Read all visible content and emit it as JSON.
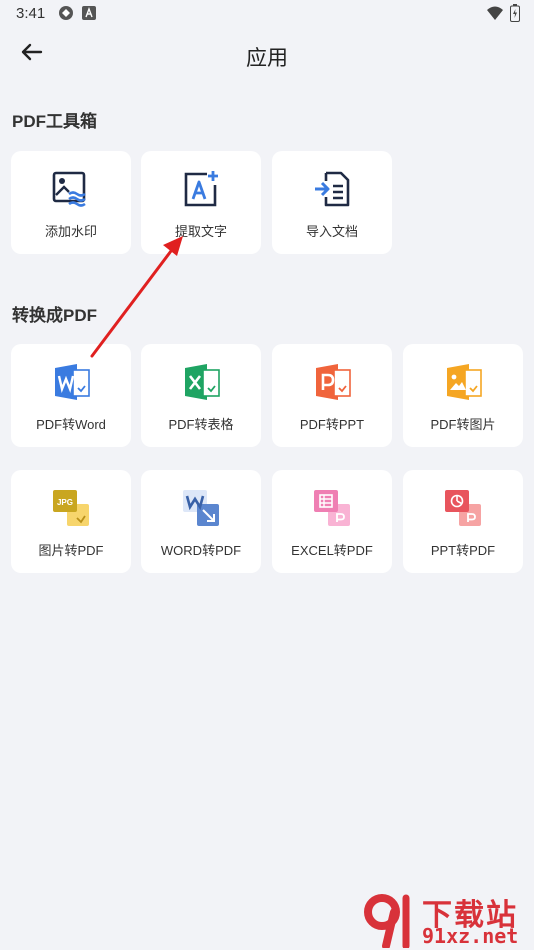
{
  "status_bar": {
    "time": "3:41"
  },
  "header": {
    "title": "应用"
  },
  "sections": [
    {
      "title": "PDF工具箱",
      "items": [
        {
          "label": "添加水印",
          "icon": "watermark-icon"
        },
        {
          "label": "提取文字",
          "icon": "extract-text-icon"
        },
        {
          "label": "导入文档",
          "icon": "import-document-icon"
        }
      ]
    },
    {
      "title": "转换成PDF",
      "items": [
        {
          "label": "PDF转Word",
          "icon": "pdf-to-word-icon"
        },
        {
          "label": "PDF转表格",
          "icon": "pdf-to-excel-icon"
        },
        {
          "label": "PDF转PPT",
          "icon": "pdf-to-ppt-icon"
        },
        {
          "label": "PDF转图片",
          "icon": "pdf-to-image-icon"
        },
        {
          "label": "图片转PDF",
          "icon": "image-to-pdf-icon"
        },
        {
          "label": "WORD转PDF",
          "icon": "word-to-pdf-icon"
        },
        {
          "label": "EXCEL转PDF",
          "icon": "excel-to-pdf-icon"
        },
        {
          "label": "PPT转PDF",
          "icon": "ppt-to-pdf-icon"
        }
      ]
    }
  ],
  "watermark": {
    "brand": "下载站",
    "domain": "91xz.net"
  },
  "colors": {
    "background": "#f2f3f7",
    "word": "#3a7be0",
    "excel": "#1fa463",
    "ppt": "#f0643c",
    "image": "#f5a623",
    "annotation_arrow": "#e02020"
  }
}
